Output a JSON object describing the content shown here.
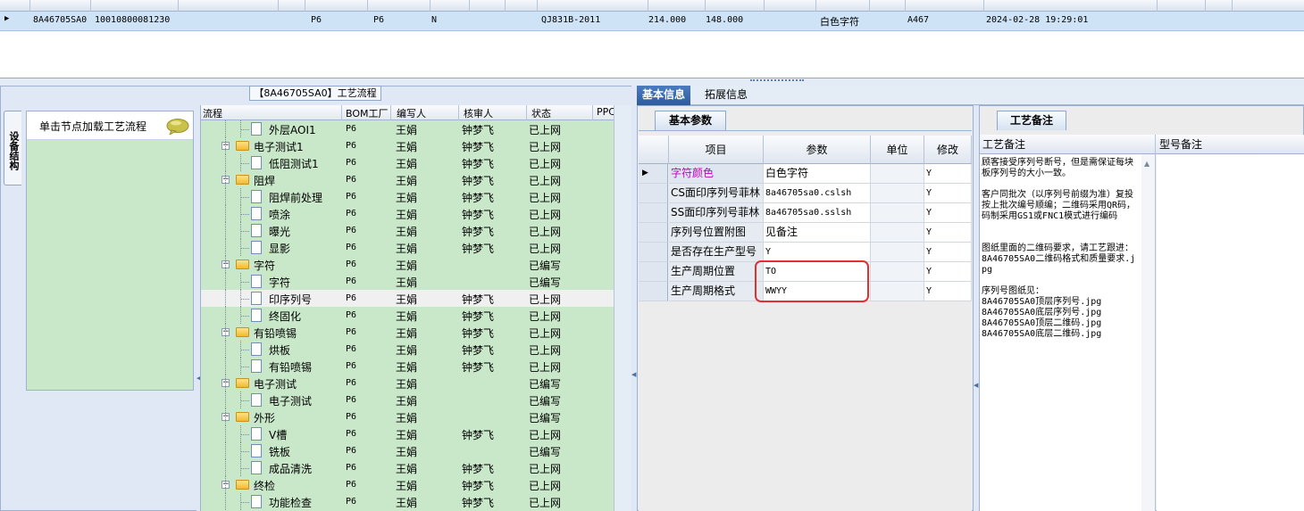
{
  "top_grid": {
    "row": {
      "col1": "8A46705SA0",
      "col2": "10010800081230",
      "col3": "",
      "col4": "P6",
      "col5": "P6",
      "col6": "N",
      "col7": "QJ831B-2011",
      "col8": "214.000",
      "col9": "148.000",
      "col10": "白色字符",
      "col11": "A467",
      "col12": "2024-02-28 19:29:01"
    }
  },
  "left": {
    "caption": "【8A46705SA0】工艺流程",
    "vertical_tab": "设备结构",
    "hint": "单击节点加载工艺流程",
    "tree_headers": {
      "flow": "流程",
      "bom": "BOM工厂",
      "writer": "编写人",
      "reviewer": "核审人",
      "status": "状态",
      "ppc": "PPC"
    },
    "rows": [
      {
        "name": "外层AOI1",
        "level": 2,
        "bom": "P6",
        "writer": "王娟",
        "reviewer": "钟梦飞",
        "status": "已上网"
      },
      {
        "name": "电子测试1",
        "level": 1,
        "bom": "P6",
        "writer": "王娟",
        "reviewer": "钟梦飞",
        "status": "已上网"
      },
      {
        "name": "低阻测试1",
        "level": 2,
        "bom": "P6",
        "writer": "王娟",
        "reviewer": "钟梦飞",
        "status": "已上网"
      },
      {
        "name": "阻焊",
        "level": 1,
        "bom": "P6",
        "writer": "王娟",
        "reviewer": "钟梦飞",
        "status": "已上网"
      },
      {
        "name": "阻焊前处理",
        "level": 2,
        "bom": "P6",
        "writer": "王娟",
        "reviewer": "钟梦飞",
        "status": "已上网"
      },
      {
        "name": "喷涂",
        "level": 2,
        "bom": "P6",
        "writer": "王娟",
        "reviewer": "钟梦飞",
        "status": "已上网"
      },
      {
        "name": "曝光",
        "level": 2,
        "bom": "P6",
        "writer": "王娟",
        "reviewer": "钟梦飞",
        "status": "已上网"
      },
      {
        "name": "显影",
        "level": 2,
        "bom": "P6",
        "writer": "王娟",
        "reviewer": "钟梦飞",
        "status": "已上网"
      },
      {
        "name": "字符",
        "level": 1,
        "bom": "P6",
        "writer": "王娟",
        "reviewer": "",
        "status": "已编写"
      },
      {
        "name": "字符",
        "level": 2,
        "bom": "P6",
        "writer": "王娟",
        "reviewer": "",
        "status": "已编写"
      },
      {
        "name": "印序列号",
        "level": 2,
        "bom": "P6",
        "writer": "王娟",
        "reviewer": "钟梦飞",
        "status": "已上网",
        "selected": true
      },
      {
        "name": "终固化",
        "level": 2,
        "bom": "P6",
        "writer": "王娟",
        "reviewer": "钟梦飞",
        "status": "已上网"
      },
      {
        "name": "有铅喷锡",
        "level": 1,
        "bom": "P6",
        "writer": "王娟",
        "reviewer": "钟梦飞",
        "status": "已上网"
      },
      {
        "name": "烘板",
        "level": 2,
        "bom": "P6",
        "writer": "王娟",
        "reviewer": "钟梦飞",
        "status": "已上网"
      },
      {
        "name": "有铅喷锡",
        "level": 2,
        "bom": "P6",
        "writer": "王娟",
        "reviewer": "钟梦飞",
        "status": "已上网"
      },
      {
        "name": "电子测试",
        "level": 1,
        "bom": "P6",
        "writer": "王娟",
        "reviewer": "",
        "status": "已编写"
      },
      {
        "name": "电子测试",
        "level": 2,
        "bom": "P6",
        "writer": "王娟",
        "reviewer": "",
        "status": "已编写"
      },
      {
        "name": "外形",
        "level": 1,
        "bom": "P6",
        "writer": "王娟",
        "reviewer": "",
        "status": "已编写"
      },
      {
        "name": "V槽",
        "level": 2,
        "bom": "P6",
        "writer": "王娟",
        "reviewer": "钟梦飞",
        "status": "已上网"
      },
      {
        "name": "铣板",
        "level": 2,
        "bom": "P6",
        "writer": "王娟",
        "reviewer": "",
        "status": "已编写"
      },
      {
        "name": "成品清洗",
        "level": 2,
        "bom": "P6",
        "writer": "王娟",
        "reviewer": "钟梦飞",
        "status": "已上网"
      },
      {
        "name": "终检",
        "level": 1,
        "bom": "P6",
        "writer": "王娟",
        "reviewer": "钟梦飞",
        "status": "已上网"
      },
      {
        "name": "功能检查",
        "level": 2,
        "bom": "P6",
        "writer": "王娟",
        "reviewer": "钟梦飞",
        "status": "已上网"
      }
    ]
  },
  "right": {
    "tabs": [
      "基本信息",
      "拓展信息"
    ],
    "subtab_params": "基本参数",
    "subtab_notes": "工艺备注",
    "param_headers": {
      "item": "项目",
      "param": "参数",
      "unit": "单位",
      "modify": "修改"
    },
    "params": [
      {
        "item": "字符颜色",
        "param": "白色字符",
        "unit": "",
        "modify": "Y",
        "current": true
      },
      {
        "item": "CS面印序列号菲林",
        "param": "8a46705sa0.cslsh",
        "unit": "",
        "modify": "Y"
      },
      {
        "item": "SS面印序列号菲林",
        "param": "8a46705sa0.sslsh",
        "unit": "",
        "modify": "Y"
      },
      {
        "item": "序列号位置附图",
        "param": "见备注",
        "unit": "",
        "modify": "Y"
      },
      {
        "item": "是否存在生产型号",
        "param": "Y",
        "unit": "",
        "modify": "Y"
      },
      {
        "item": "生产周期位置",
        "param": "TO",
        "unit": "",
        "modify": "Y"
      },
      {
        "item": "生产周期格式",
        "param": "WWYY",
        "unit": "",
        "modify": "Y"
      }
    ],
    "notes_header": "工艺备注",
    "model_notes_header": "型号备注",
    "notes_text": "顾客接受序列号断号，但是需保证每块板序列号的大小一致。\n\n客户同批次（以序列号前缀为准）复投按上批次编号顺编；二维码采用QR码，码制采用GS1或FNC1模式进行编码\n\n\n图纸里面的二维码要求，请工艺跟进：8A46705SA0二维码格式和质量要求.jpg\n\n序列号图纸见：\n8A46705SA0顶层序列号.jpg\n8A46705SA0底层序列号.jpg\n8A46705SA0顶层二维码.jpg\n8A46705SA0底层二维码.jpg"
  },
  "colors": {
    "tree_bg": "#c9e7c9",
    "accent": "#2e5a9e",
    "highlight": "#e03030",
    "param_item_current": "#c000c0"
  }
}
